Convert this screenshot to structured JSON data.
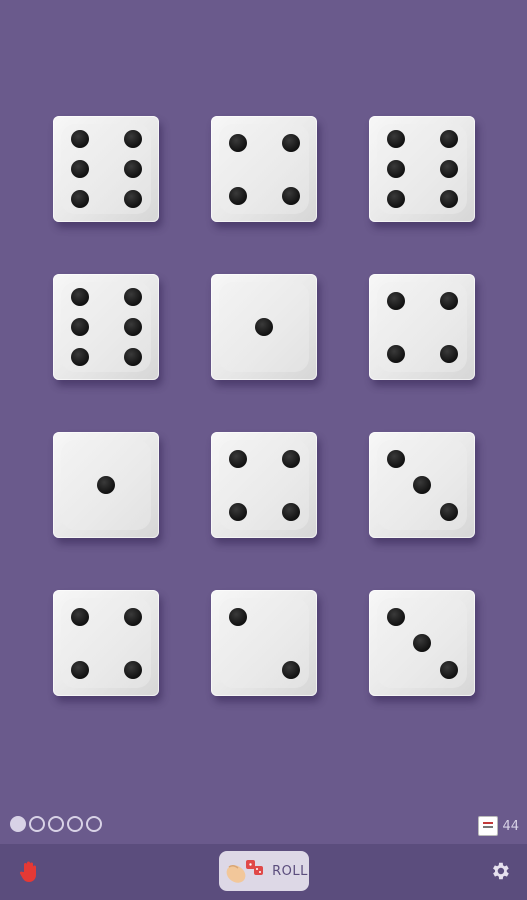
{
  "dice": [
    {
      "value": 6
    },
    {
      "value": 4
    },
    {
      "value": 6
    },
    {
      "value": 6
    },
    {
      "value": 1
    },
    {
      "value": 4
    },
    {
      "value": 1
    },
    {
      "value": 4
    },
    {
      "value": 3
    },
    {
      "value": 4
    },
    {
      "value": 2
    },
    {
      "value": 3
    }
  ],
  "pager": {
    "count": 5,
    "active_index": 0
  },
  "counter": {
    "icon": "score-card-icon",
    "value": "44"
  },
  "toolbar": {
    "hold_icon": "hand-icon",
    "roll_label": "ROLL",
    "roll_icon": "hand-with-dice-icon",
    "settings_icon": "gear-icon"
  },
  "colors": {
    "background": "#6a5a8c",
    "bottom_bar": "#5b4d7d",
    "hand_icon": "#e53935",
    "roll_button": "#ddd8e6"
  }
}
